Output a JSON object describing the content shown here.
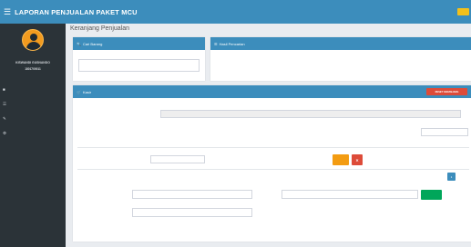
{
  "header": {
    "menu_icon": "hamburger-icon",
    "title": "LAPORAN PENJUALAN PAKET MCU",
    "subtitle": "",
    "logout_label": ""
  },
  "sidebar": {
    "user_name": "KISWANDI GUSNANDO",
    "user_id": "1801700011",
    "items": [
      {
        "label": "",
        "icon": "dashboard-icon"
      },
      {
        "label": "",
        "icon": "menu-icon"
      },
      {
        "label": "",
        "icon": "pencil-icon"
      },
      {
        "label": "",
        "icon": "gear-icon"
      }
    ]
  },
  "page": {
    "title": "Keranjang Penjualan"
  },
  "cari_barang": {
    "title": "Cari Barang",
    "placeholder": ""
  },
  "hasil_pencarian": {
    "title": "Hasil Pencarian"
  },
  "kasir": {
    "title": "Kasir",
    "reset_label": "RESET KERANJANG",
    "tanggal_label": "",
    "tanggal_value": "",
    "show_label": "",
    "search_label": "",
    "table_headers": [
      "",
      "",
      "",
      "",
      "",
      "",
      ""
    ],
    "rows": [
      {
        "no": "",
        "nama": "",
        "qty": "",
        "harga": "",
        "total": "",
        "update_label": "",
        "delete_label": "✕"
      }
    ],
    "info_text": "",
    "pagination": {
      "prev": "",
      "current": "1",
      "next": ""
    },
    "total_label": "",
    "total_value": "",
    "bayar_label": "",
    "bayar_button": "",
    "kembali_label": "",
    "kembali_value": ""
  },
  "colors": {
    "primary": "#3c8dbc",
    "sidebar": "#2b3338",
    "danger": "#dd4b39",
    "warning": "#f39c12",
    "success": "#00a65a",
    "logout": "#f3c01b"
  }
}
